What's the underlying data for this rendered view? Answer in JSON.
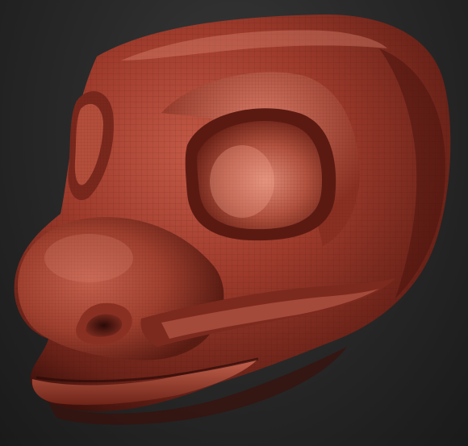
{
  "scene": {
    "subject": "sculpted-creature-head",
    "colors": {
      "background_top": "#3a3a3a",
      "background_bottom": "#171717",
      "clay_base": "#9a3a2c",
      "clay_light": "#d06a58",
      "clay_highlight": "#ef9a86",
      "clay_shadow": "#4a1510",
      "clay_deep_shadow": "#2a0a07",
      "wire": "#5a1a12"
    }
  }
}
